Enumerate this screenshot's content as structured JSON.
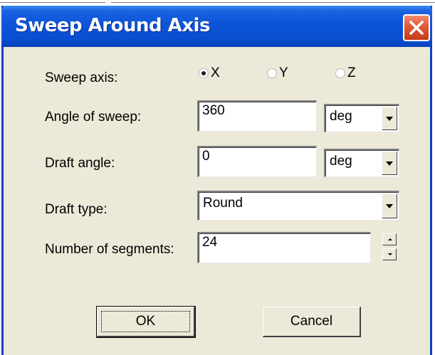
{
  "dialog": {
    "title": "Sweep Around Axis"
  },
  "sweep_axis": {
    "label": "Sweep axis:",
    "options": [
      "X",
      "Y",
      "Z"
    ],
    "selected": "X"
  },
  "angle_of_sweep": {
    "label": "Angle of sweep:",
    "value": "360",
    "unit": "deg"
  },
  "draft_angle": {
    "label": "Draft angle:",
    "value": "0",
    "unit": "deg"
  },
  "draft_type": {
    "label": "Draft type:",
    "value": "Round"
  },
  "segments": {
    "label": "Number of segments:",
    "value": "24"
  },
  "buttons": {
    "ok": "OK",
    "cancel": "Cancel"
  },
  "colors": {
    "titlebar": "#0b54d8",
    "dialog_face": "#ece9d8",
    "close_button": "#e05a36"
  },
  "icons": [
    "close-icon",
    "chevron-down-icon",
    "spin-up-icon",
    "spin-down-icon"
  ]
}
